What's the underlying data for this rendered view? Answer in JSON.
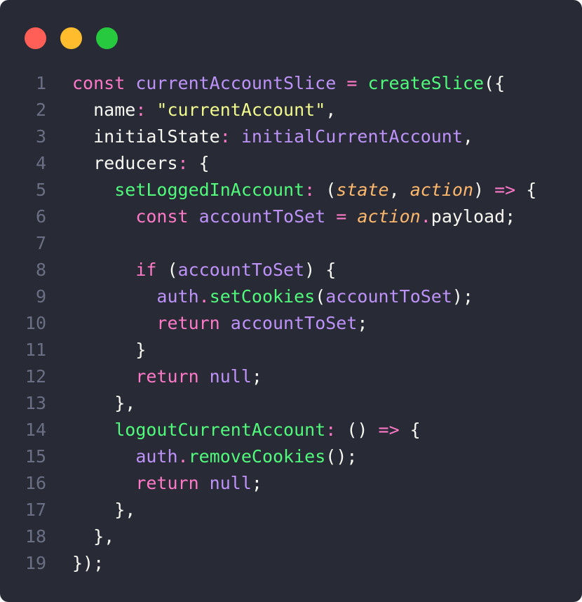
{
  "window": {
    "traffic_lights": [
      {
        "name": "close",
        "color": "#ff5f56"
      },
      {
        "name": "minimize",
        "color": "#ffbd2e"
      },
      {
        "name": "maximize",
        "color": "#27c93f"
      }
    ]
  },
  "theme": {
    "background": "#282a36",
    "keyword": "#ff79c6",
    "identifier": "#bd93f9",
    "function": "#50fa7b",
    "string": "#f1fa8c",
    "param": "#ffb86c",
    "plain": "#f8f8f2",
    "line_number": "#6b6f84"
  },
  "code": {
    "lines": [
      {
        "number": "1",
        "tokens": [
          {
            "text": "const ",
            "kind": "keyword"
          },
          {
            "text": "currentAccountSlice",
            "kind": "identifier"
          },
          {
            "text": " = ",
            "kind": "keyword"
          },
          {
            "text": "createSlice",
            "kind": "function"
          },
          {
            "text": "({",
            "kind": "plain"
          }
        ]
      },
      {
        "number": "2",
        "tokens": [
          {
            "text": "  name",
            "kind": "plain"
          },
          {
            "text": ": ",
            "kind": "keyword"
          },
          {
            "text": "\"currentAccount\"",
            "kind": "string"
          },
          {
            "text": ",",
            "kind": "plain"
          }
        ]
      },
      {
        "number": "3",
        "tokens": [
          {
            "text": "  initialState",
            "kind": "plain"
          },
          {
            "text": ": ",
            "kind": "keyword"
          },
          {
            "text": "initialCurrentAccount",
            "kind": "identifier"
          },
          {
            "text": ",",
            "kind": "plain"
          }
        ]
      },
      {
        "number": "4",
        "tokens": [
          {
            "text": "  reducers",
            "kind": "plain"
          },
          {
            "text": ": ",
            "kind": "keyword"
          },
          {
            "text": "{",
            "kind": "plain"
          }
        ]
      },
      {
        "number": "5",
        "tokens": [
          {
            "text": "    ",
            "kind": "plain"
          },
          {
            "text": "setLoggedInAccount",
            "kind": "function"
          },
          {
            "text": ": ",
            "kind": "keyword"
          },
          {
            "text": "(",
            "kind": "plain"
          },
          {
            "text": "state",
            "kind": "param"
          },
          {
            "text": ", ",
            "kind": "plain"
          },
          {
            "text": "action",
            "kind": "param"
          },
          {
            "text": ") ",
            "kind": "plain"
          },
          {
            "text": "=>",
            "kind": "keyword"
          },
          {
            "text": " {",
            "kind": "plain"
          }
        ]
      },
      {
        "number": "6",
        "tokens": [
          {
            "text": "      ",
            "kind": "plain"
          },
          {
            "text": "const ",
            "kind": "keyword"
          },
          {
            "text": "accountToSet",
            "kind": "identifier"
          },
          {
            "text": " = ",
            "kind": "keyword"
          },
          {
            "text": "action",
            "kind": "param"
          },
          {
            "text": ".",
            "kind": "keyword"
          },
          {
            "text": "payload;",
            "kind": "plain"
          }
        ]
      },
      {
        "number": "7",
        "tokens": []
      },
      {
        "number": "8",
        "tokens": [
          {
            "text": "      ",
            "kind": "plain"
          },
          {
            "text": "if ",
            "kind": "keyword"
          },
          {
            "text": "(",
            "kind": "plain"
          },
          {
            "text": "accountToSet",
            "kind": "identifier"
          },
          {
            "text": ") {",
            "kind": "plain"
          }
        ]
      },
      {
        "number": "9",
        "tokens": [
          {
            "text": "        ",
            "kind": "plain"
          },
          {
            "text": "auth",
            "kind": "identifier"
          },
          {
            "text": ".",
            "kind": "keyword"
          },
          {
            "text": "setCookies",
            "kind": "function"
          },
          {
            "text": "(",
            "kind": "plain"
          },
          {
            "text": "accountToSet",
            "kind": "identifier"
          },
          {
            "text": ");",
            "kind": "plain"
          }
        ]
      },
      {
        "number": "10",
        "tokens": [
          {
            "text": "        ",
            "kind": "plain"
          },
          {
            "text": "return ",
            "kind": "keyword"
          },
          {
            "text": "accountToSet",
            "kind": "identifier"
          },
          {
            "text": ";",
            "kind": "plain"
          }
        ]
      },
      {
        "number": "11",
        "tokens": [
          {
            "text": "      }",
            "kind": "plain"
          }
        ]
      },
      {
        "number": "12",
        "tokens": [
          {
            "text": "      ",
            "kind": "plain"
          },
          {
            "text": "return ",
            "kind": "keyword"
          },
          {
            "text": "null",
            "kind": "identifier"
          },
          {
            "text": ";",
            "kind": "plain"
          }
        ]
      },
      {
        "number": "13",
        "tokens": [
          {
            "text": "    },",
            "kind": "plain"
          }
        ]
      },
      {
        "number": "14",
        "tokens": [
          {
            "text": "    ",
            "kind": "plain"
          },
          {
            "text": "logoutCurrentAccount",
            "kind": "function"
          },
          {
            "text": ": ",
            "kind": "keyword"
          },
          {
            "text": "() ",
            "kind": "plain"
          },
          {
            "text": "=>",
            "kind": "keyword"
          },
          {
            "text": " {",
            "kind": "plain"
          }
        ]
      },
      {
        "number": "15",
        "tokens": [
          {
            "text": "      ",
            "kind": "plain"
          },
          {
            "text": "auth",
            "kind": "identifier"
          },
          {
            "text": ".",
            "kind": "keyword"
          },
          {
            "text": "removeCookies",
            "kind": "function"
          },
          {
            "text": "();",
            "kind": "plain"
          }
        ]
      },
      {
        "number": "16",
        "tokens": [
          {
            "text": "      ",
            "kind": "plain"
          },
          {
            "text": "return ",
            "kind": "keyword"
          },
          {
            "text": "null",
            "kind": "identifier"
          },
          {
            "text": ";",
            "kind": "plain"
          }
        ]
      },
      {
        "number": "17",
        "tokens": [
          {
            "text": "    },",
            "kind": "plain"
          }
        ]
      },
      {
        "number": "18",
        "tokens": [
          {
            "text": "  },",
            "kind": "plain"
          }
        ]
      },
      {
        "number": "19",
        "tokens": [
          {
            "text": "});",
            "kind": "plain"
          }
        ]
      }
    ]
  }
}
